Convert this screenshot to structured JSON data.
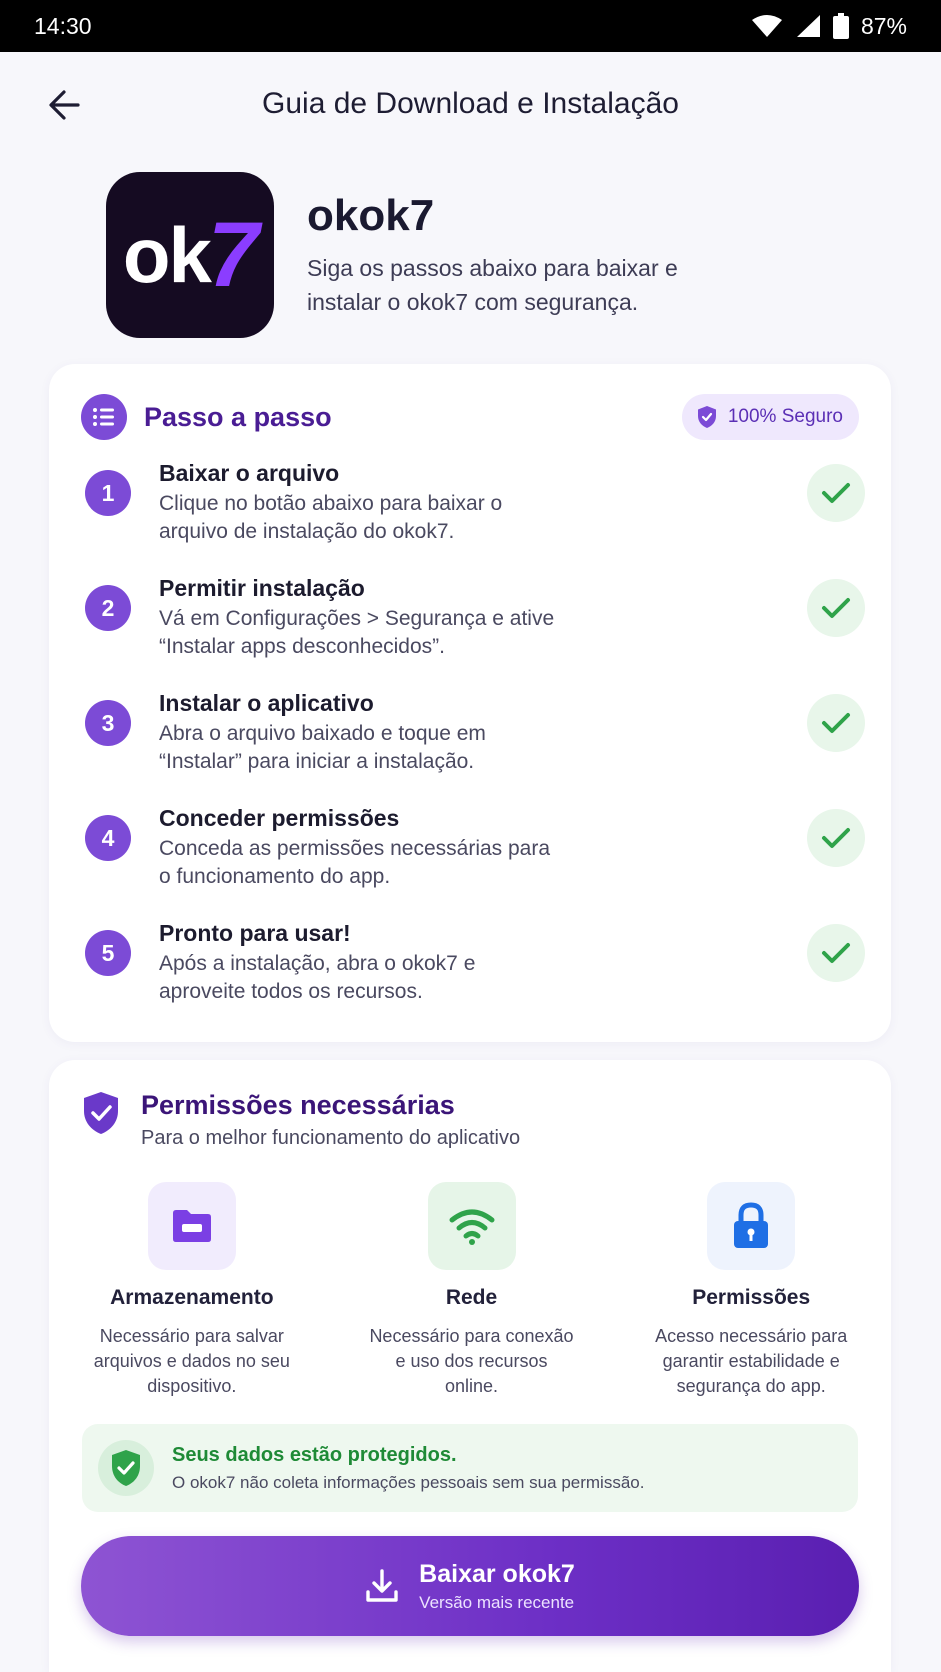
{
  "status_bar": {
    "time": "14:30",
    "battery": "87%"
  },
  "header": {
    "title": "Guia de Download e Instalação"
  },
  "app": {
    "logo_ok": "ok",
    "logo_seven": "7",
    "name": "okok7",
    "description": "Siga os passos abaixo para baixar e instalar o okok7 com segurança."
  },
  "steps_card": {
    "title": "Passo a passo",
    "badge": "100% Seguro",
    "steps": [
      {
        "number": "1",
        "title": "Baixar o arquivo",
        "description": "Clique no botão abaixo para baixar o arquivo de instalação do okok7."
      },
      {
        "number": "2",
        "title": "Permitir instalação",
        "description": "Vá em Configurações > Segurança e ative “Instalar apps desconhecidos”."
      },
      {
        "number": "3",
        "title": "Instalar o aplicativo",
        "description": "Abra o arquivo baixado e toque em “Instalar” para iniciar a instalação."
      },
      {
        "number": "4",
        "title": "Conceder permissões",
        "description": "Conceda as permissões necessárias para o funcionamento do app."
      },
      {
        "number": "5",
        "title": "Pronto para usar!",
        "description": "Após a instalação, abra o okok7 e aproveite todos os recursos."
      }
    ]
  },
  "permissions_card": {
    "title": "Permissões necessárias",
    "subtitle": "Para o melhor funcionamento do aplicativo",
    "items": [
      {
        "name": "Armazenamento",
        "description": "Necessário para salvar arquivos e dados no seu dispositivo.",
        "icon": "folder-icon"
      },
      {
        "name": "Rede",
        "description": "Necessário para conexão e uso dos recursos online.",
        "icon": "wifi-icon"
      },
      {
        "name": "Permissões",
        "description": "Acesso necessário para garantir estabilidade e segurança do app.",
        "icon": "lock-icon"
      }
    ],
    "protected": {
      "title": "Seus dados estão protegidos.",
      "description": "O okok7 não coleta informações pessoais sem sua permissão."
    }
  },
  "download_button": {
    "label": "Baixar okok7",
    "sublabel": "Versão mais recente"
  },
  "colors": {
    "accent": "#7c4bd6",
    "success": "#2fa34a",
    "title_purple": "#4a1d94"
  }
}
